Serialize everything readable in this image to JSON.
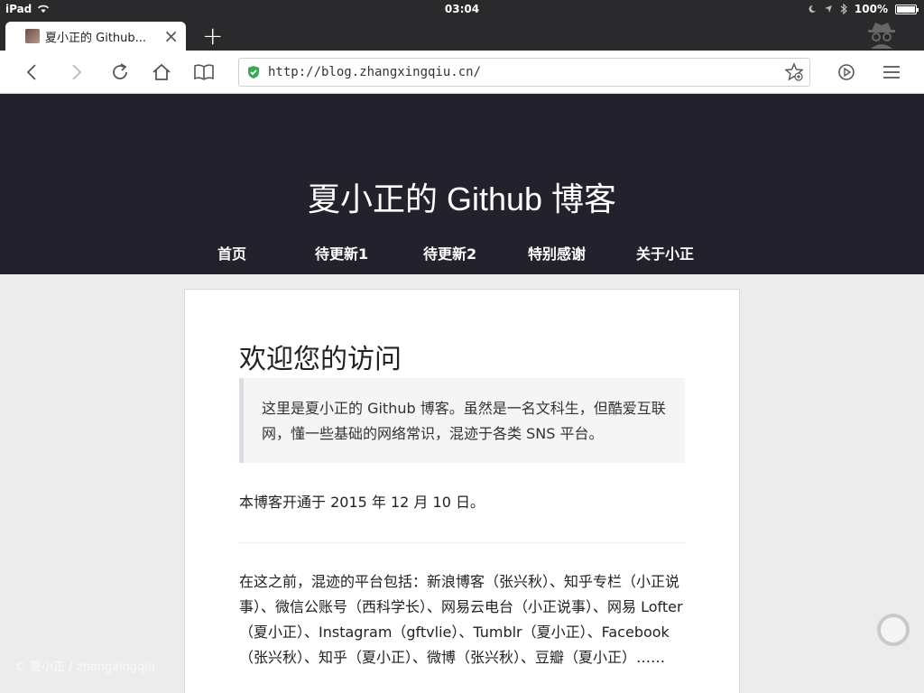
{
  "status_bar": {
    "device": "iPad",
    "time": "03:04",
    "battery": "100%"
  },
  "tab": {
    "title": "夏小正的 Github...",
    "close": "×",
    "new_tab": "+"
  },
  "toolbar": {
    "url": "http://blog.zhangxingqiu.cn/"
  },
  "site": {
    "title": "夏小正的 Github 博客",
    "nav": [
      "首页",
      "待更新1",
      "待更新2",
      "特别感谢",
      "关于小正"
    ]
  },
  "content": {
    "heading": "欢迎您的访问",
    "quote": "这里是夏小正的 Github 博客。虽然是一名文科生，但酷爱互联网，懂一些基础的网络常识，混迹于各类 SNS 平台。",
    "para1": "本博客开通于 2015 年 12 月 10 日。",
    "para2": "在这之前，混迹的平台包括：新浪博客（张兴秋）、知乎专栏（小正说事）、微信公账号（西科学长）、网易云电台（小正说事）、网易 Lofter（夏小正）、Instagram（gftvlie）、Tumblr（夏小正）、Facebook（张兴秋）、知乎（夏小正）、微博（张兴秋）、豆瓣（夏小正）……"
  },
  "watermark": "© 夏小正 / zhangxingqiu",
  "colors": {
    "header_bg": "#23222c",
    "chrome_bg": "#2a2a2d",
    "shield_green": "#3aa757"
  }
}
